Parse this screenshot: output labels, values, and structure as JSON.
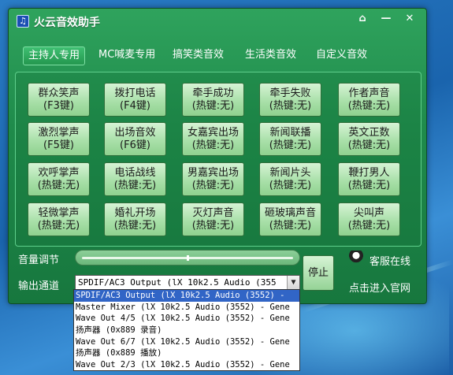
{
  "window": {
    "title": "火云音效助手",
    "icon_glyph": "♫"
  },
  "title_buttons": {
    "skin": "⌂",
    "minimize": "—",
    "close": "✕"
  },
  "tabs": [
    {
      "label": "主持人专用",
      "active": true
    },
    {
      "label": "MC喊麦专用",
      "active": false
    },
    {
      "label": "搞笑类音效",
      "active": false
    },
    {
      "label": "生活类音效",
      "active": false
    },
    {
      "label": "自定义音效",
      "active": false
    }
  ],
  "effects": [
    {
      "name": "群众笑声",
      "hotkey": "(F3键)"
    },
    {
      "name": "拨打电话",
      "hotkey": "(F4键)"
    },
    {
      "name": "牵手成功",
      "hotkey": "(热键:无)"
    },
    {
      "name": "牵手失败",
      "hotkey": "(热键:无)"
    },
    {
      "name": "作者声音",
      "hotkey": "(热键:无)"
    },
    {
      "name": "激烈掌声",
      "hotkey": "(F5键)"
    },
    {
      "name": "出场音效",
      "hotkey": "(F6键)"
    },
    {
      "name": "女嘉宾出场",
      "hotkey": "(热键:无)"
    },
    {
      "name": "新闻联播",
      "hotkey": "(热键:无)"
    },
    {
      "name": "英文正数",
      "hotkey": "(热键:无)"
    },
    {
      "name": "欢呼掌声",
      "hotkey": "(热键:无)"
    },
    {
      "name": "电话战线",
      "hotkey": "(热键:无)"
    },
    {
      "name": "男嘉宾出场",
      "hotkey": "(热键:无)"
    },
    {
      "name": "新闻片头",
      "hotkey": "(热键:无)"
    },
    {
      "name": "鞭打男人",
      "hotkey": "(热键:无)"
    },
    {
      "name": "轻微掌声",
      "hotkey": "(热键:无)"
    },
    {
      "name": "婚礼开场",
      "hotkey": "(热键:无)"
    },
    {
      "name": "灭灯声音",
      "hotkey": "(热键:无)"
    },
    {
      "name": "砸玻璃声音",
      "hotkey": "(热键:无)"
    },
    {
      "name": "尖叫声",
      "hotkey": "(热键:无)"
    }
  ],
  "volume": {
    "label": "音量调节",
    "level": 0.5
  },
  "output": {
    "label": "输出通道",
    "selected": "SPDIF/AC3 Output (lX 10k2.5 Audio (355",
    "arrow": "▼",
    "options": [
      "SPDIF/AC3 Output (lX 10k2.5 Audio (3552) -",
      "Master Mixer (lX 10k2.5 Audio (3552) - Gene",
      "Wave Out 4/5 (lX 10k2.5 Audio (3552) - Gene",
      "扬声器 (0x889 录音)",
      "Wave Out 6/7 (lX 10k2.5 Audio (3552) - Gene",
      "扬声器 (0x889 播放)",
      "Wave Out 2/3 (lX 10k2.5 Audio (3552) - Gene"
    ]
  },
  "stop_label": "停止",
  "support": {
    "qq_label": "客服在线",
    "site_label": "点击进入官网"
  }
}
